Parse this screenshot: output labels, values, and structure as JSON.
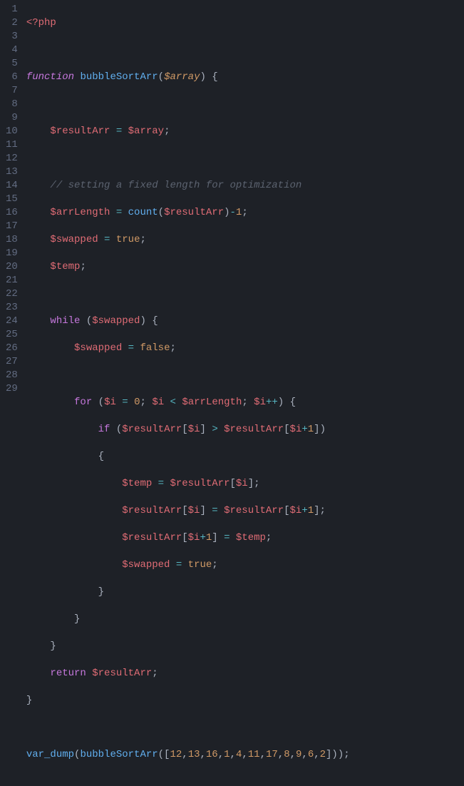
{
  "gutter": {
    "lines": [
      "1",
      "2",
      "3",
      "4",
      "5",
      "6",
      "7",
      "8",
      "9",
      "10",
      "11",
      "12",
      "13",
      "14",
      "15",
      "16",
      "17",
      "18",
      "19",
      "20",
      "21",
      "22",
      "23",
      "24",
      "25",
      "26",
      "27",
      "28",
      "29"
    ]
  },
  "code": {
    "l1_open": "<?php",
    "l3_kw": "function",
    "l3_fn": "bubbleSortArr",
    "l3_p1": "(",
    "l3_param": "$array",
    "l3_p2": ")",
    "l3_brace": " {",
    "l5_var": "$resultArr",
    "l5_op": " = ",
    "l5_rhs": "$array",
    "l5_semi": ";",
    "l7_comment": "// setting a fixed length for optimization",
    "l8_var": "$arrLength",
    "l8_op": " = ",
    "l8_call": "count",
    "l8_p1": "(",
    "l8_arg": "$resultArr",
    "l8_p2": ")",
    "l8_minus": "-",
    "l8_num": "1",
    "l8_semi": ";",
    "l9_var": "$swapped",
    "l9_op": " = ",
    "l9_val": "true",
    "l9_semi": ";",
    "l10_var": "$temp",
    "l10_semi": ";",
    "l12_kw": "while",
    "l12_p1": " (",
    "l12_cond": "$swapped",
    "l12_p2": ") {",
    "l13_var": "$swapped",
    "l13_op": " = ",
    "l13_val": "false",
    "l13_semi": ";",
    "l15_kw": "for",
    "l15_p1": " (",
    "l15_i1": "$i",
    "l15_eq": " = ",
    "l15_zero": "0",
    "l15_s1": "; ",
    "l15_i2": "$i",
    "l15_lt": " < ",
    "l15_len": "$arrLength",
    "l15_s2": "; ",
    "l15_i3": "$i",
    "l15_inc": "++",
    "l15_p2": ") {",
    "l16_kw": "if",
    "l16_p1": " (",
    "l16_a1": "$resultArr",
    "l16_b1": "[",
    "l16_i1": "$i",
    "l16_b2": "] ",
    "l16_gt": ">",
    "l16_sp": " ",
    "l16_a2": "$resultArr",
    "l16_b3": "[",
    "l16_i2": "$i",
    "l16_plus": "+",
    "l16_one": "1",
    "l16_b4": "])",
    "l17_brace": "{",
    "l18_var": "$temp",
    "l18_op": " = ",
    "l18_arr": "$resultArr",
    "l18_b1": "[",
    "l18_i": "$i",
    "l18_b2": "];",
    "l19_arr1": "$resultArr",
    "l19_b1": "[",
    "l19_i1": "$i",
    "l19_b2": "] ",
    "l19_op": "=",
    "l19_sp": " ",
    "l19_arr2": "$resultArr",
    "l19_b3": "[",
    "l19_i2": "$i",
    "l19_plus": "+",
    "l19_one": "1",
    "l19_b4": "];",
    "l20_arr": "$resultArr",
    "l20_b1": "[",
    "l20_i": "$i",
    "l20_plus": "+",
    "l20_one": "1",
    "l20_b2": "] ",
    "l20_op": "=",
    "l20_sp": " ",
    "l20_tmp": "$temp",
    "l20_semi": ";",
    "l21_var": "$swapped",
    "l21_op": " = ",
    "l21_val": "true",
    "l21_semi": ";",
    "l22_brace": "}",
    "l23_brace": "}",
    "l24_brace": "}",
    "l25_kw": "return",
    "l25_sp": " ",
    "l25_var": "$resultArr",
    "l25_semi": ";",
    "l26_brace": "}",
    "l28_fn1": "var_dump",
    "l28_p1": "(",
    "l28_fn2": "bubbleSortArr",
    "l28_p2": "([",
    "l28_n1": "12",
    "l28_c": ",",
    "l28_n2": "13",
    "l28_n3": "16",
    "l28_n4": "1",
    "l28_n5": "4",
    "l28_n6": "11",
    "l28_n7": "17",
    "l28_n8": "8",
    "l28_n9": "9",
    "l28_n10": "6",
    "l28_n11": "2",
    "l28_p3": "]));"
  }
}
